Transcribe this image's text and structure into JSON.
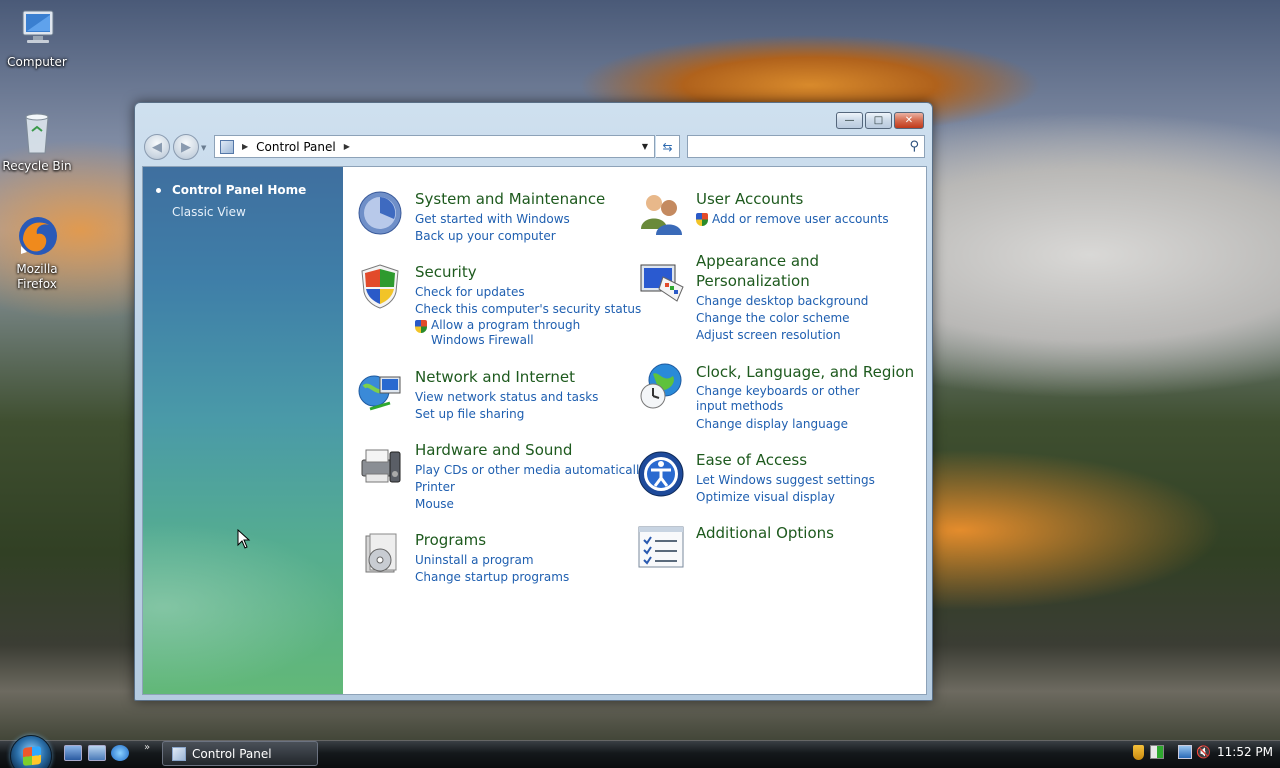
{
  "desktop": {
    "icons": [
      {
        "label": "Computer",
        "icon": "computer-icon"
      },
      {
        "label": "Recycle Bin",
        "icon": "recycle-bin-icon"
      },
      {
        "label": "Mozilla Firefox",
        "icon": "firefox-icon"
      }
    ]
  },
  "window": {
    "address": {
      "location": "Control Panel"
    },
    "search": {
      "placeholder": ""
    },
    "sidebar": {
      "home_label": "Control Panel Home",
      "classic_label": "Classic View"
    },
    "categories": [
      {
        "title": "System and Maintenance",
        "icon": "system-maintenance-icon",
        "links": [
          "Get started with Windows",
          "Back up your computer"
        ]
      },
      {
        "title": "Security",
        "icon": "security-shield-icon",
        "links": [
          "Check for updates",
          "Check this computer's security status",
          "Allow a program through Windows Firewall"
        ]
      },
      {
        "title": "Network and Internet",
        "icon": "network-internet-icon",
        "links": [
          "View network status and tasks",
          "Set up file sharing"
        ]
      },
      {
        "title": "Hardware and Sound",
        "icon": "hardware-sound-icon",
        "links": [
          "Play CDs or other media automatically",
          "Printer",
          "Mouse"
        ]
      },
      {
        "title": "Programs",
        "icon": "programs-icon",
        "links": [
          "Uninstall a program",
          "Change startup programs"
        ]
      },
      {
        "title": "User Accounts",
        "icon": "user-accounts-icon",
        "links": [
          "Add or remove user accounts"
        ]
      },
      {
        "title": "Appearance and Personalization",
        "icon": "appearance-icon",
        "links": [
          "Change desktop background",
          "Change the color scheme",
          "Adjust screen resolution"
        ]
      },
      {
        "title": "Clock, Language, and Region",
        "icon": "clock-language-icon",
        "links": [
          "Change keyboards or other input methods",
          "Change display language"
        ]
      },
      {
        "title": "Ease of Access",
        "icon": "ease-of-access-icon",
        "links": [
          "Let Windows suggest settings",
          "Optimize visual display"
        ]
      },
      {
        "title": "Additional Options",
        "icon": "additional-options-icon",
        "links": []
      }
    ]
  },
  "taskbar": {
    "task_label": "Control Panel",
    "clock": "11:52 PM"
  }
}
